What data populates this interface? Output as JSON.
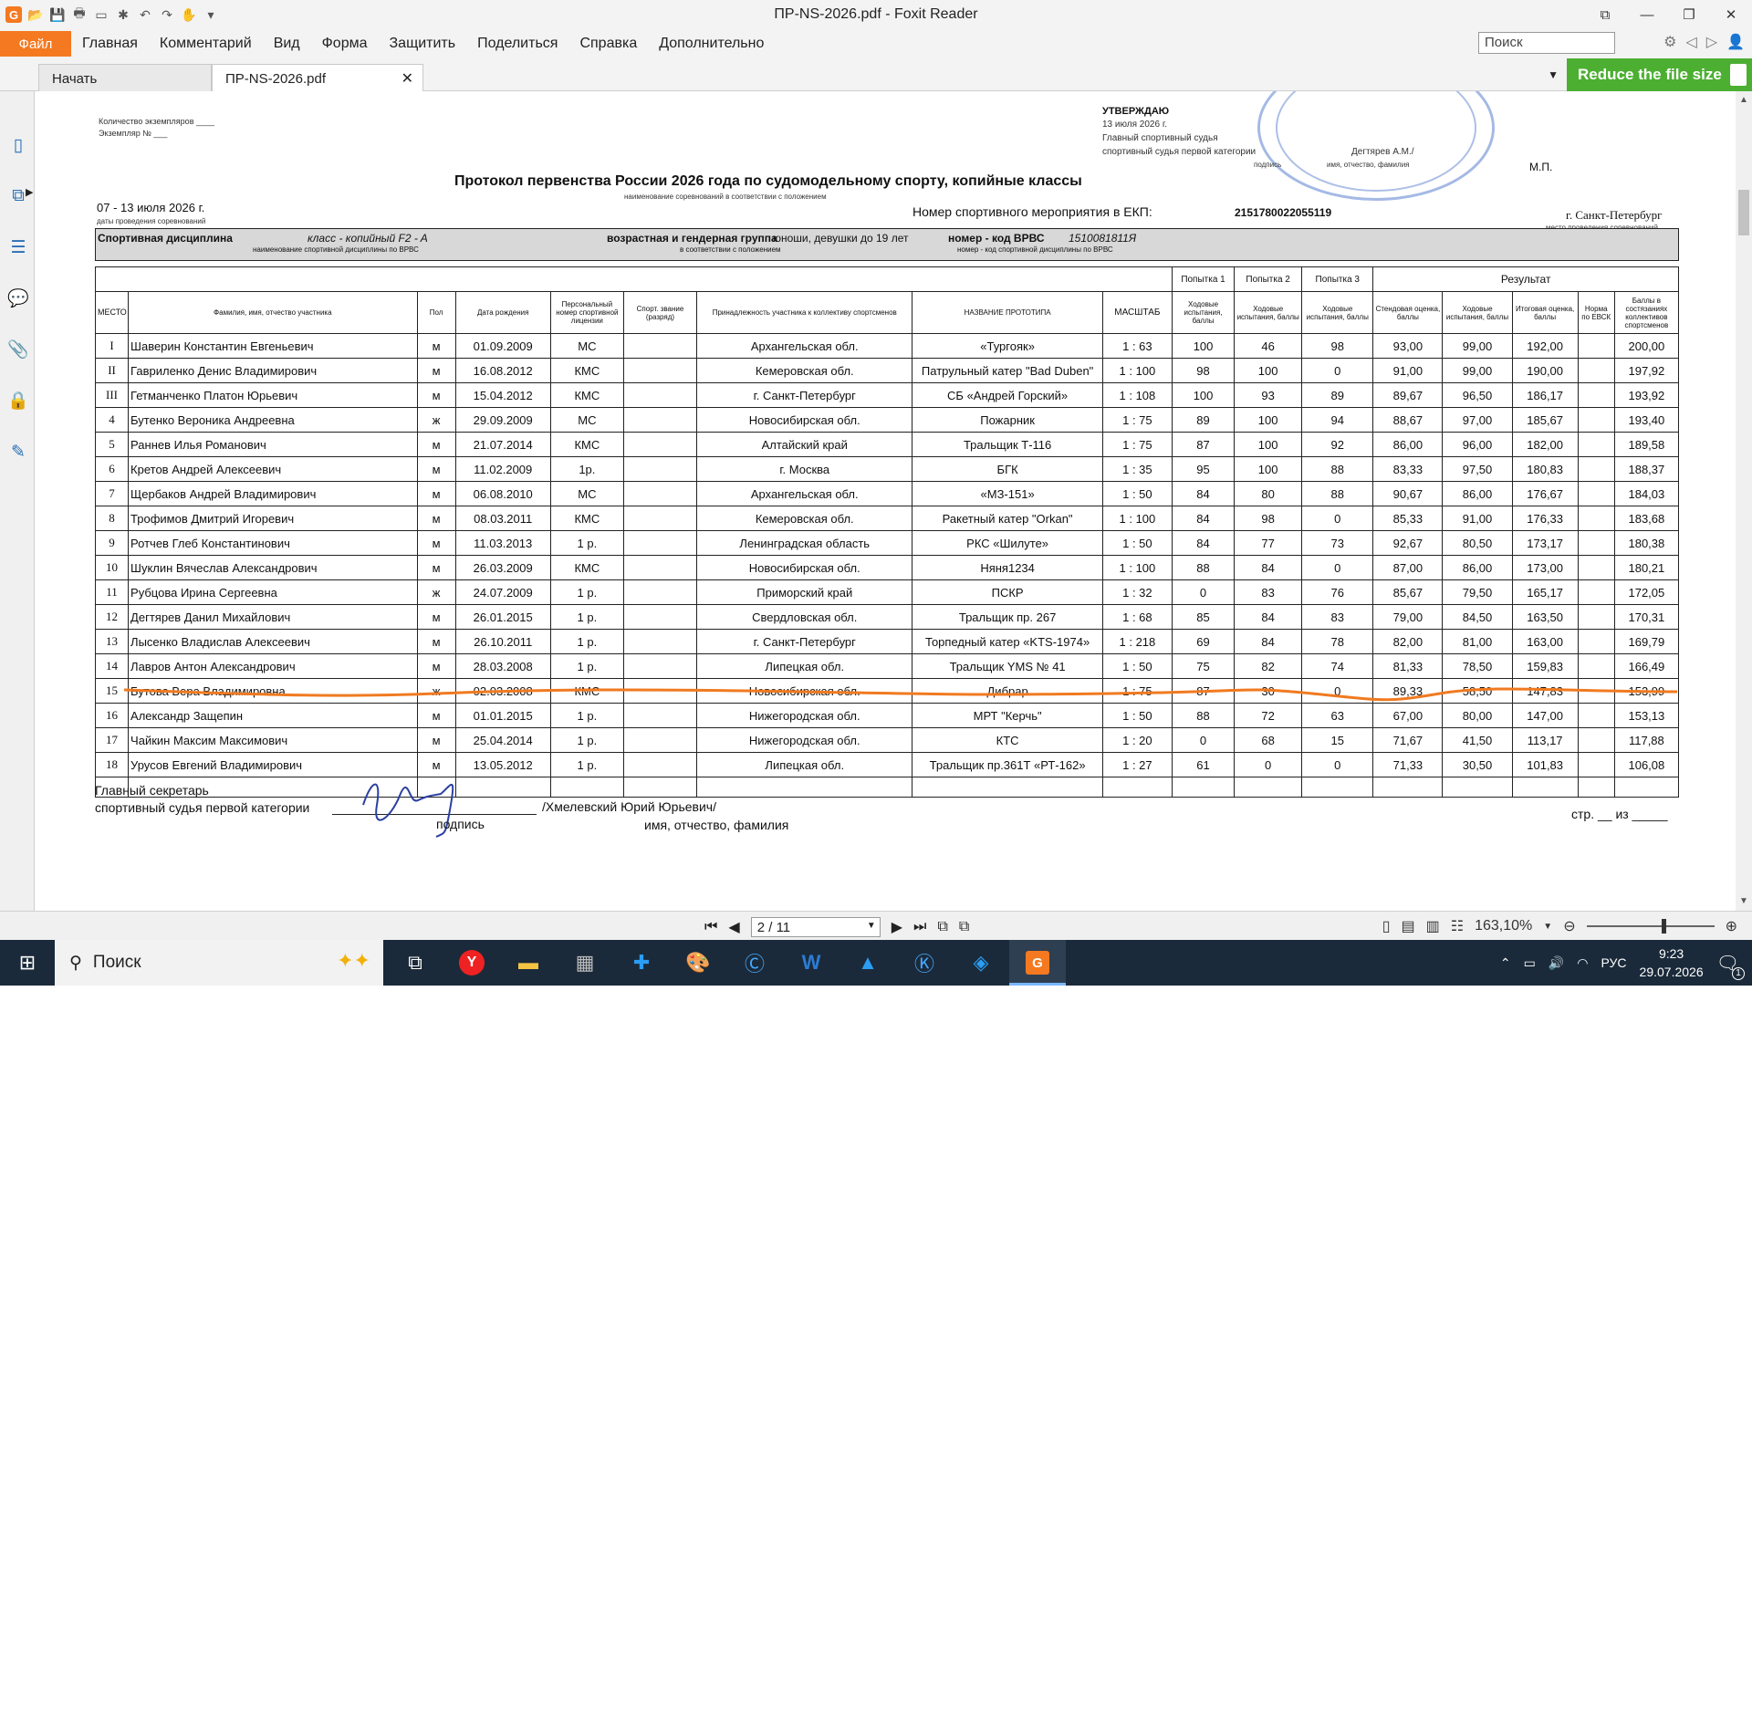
{
  "window": {
    "title": "ПР-NS-2026.pdf - Foxit Reader"
  },
  "menu": {
    "file": "Файл",
    "items": [
      "Главная",
      "Комментарий",
      "Вид",
      "Форма",
      "Защитить",
      "Поделиться",
      "Справка",
      "Дополнительно"
    ],
    "search_placeholder": "Поиск"
  },
  "tabs": [
    {
      "label": "Начать"
    },
    {
      "label": "ПР-NS-2026.pdf"
    }
  ],
  "promo": {
    "label": "Reduce the file size"
  },
  "status": {
    "page": "2 / 11",
    "zoom": "163,10%"
  },
  "taskbar": {
    "search": "Поиск",
    "lang": "РУС",
    "time": "9:23",
    "date": "29.07.2026",
    "notifications": "1"
  },
  "document": {
    "copies": "Количество экземпляров ____",
    "copy_no": "Экземпляр № ___",
    "approve": "УТВЕРЖДАЮ",
    "approve_date": "13 июля 2026 г.",
    "approve_role1": "Главный спортивный судья",
    "approve_role2": "спортивный судья первой категории",
    "approve_sign": "подпись",
    "approve_name": "Дегтярев А.М./",
    "approve_name_caption": "имя, отчество, фамилия",
    "mp": "М.П.",
    "title": "Протокол первенства России 2026 года по судомодельному спорту, копийные классы",
    "title_caption": "наименование соревнований в соответствии с положением",
    "dates": "07 - 13 июля 2026 г.",
    "dates_caption": "даты проведения соревнований",
    "ekp_label": "Номер спортивного мероприятия в ЕКП:",
    "ekp_value": "2151780022055119",
    "city": "г. Санкт-Петербург",
    "city_caption": "место проведения соревнований",
    "discipline_label": "Спортивная дисциплина",
    "discipline_value": "класс - копийный  F2 - A",
    "discipline_caption": "наименование спортивной дисциплины по ВРВС",
    "age_label": "возрастная и гендерная группа",
    "age_value": "юноши, девушки до 19 лет",
    "age_caption": "в соответствии с положением",
    "code_label": "номер - код ВРВС",
    "code_value": "1510081811Я",
    "code_caption": "номер - код спортивной дисциплины по ВРВС",
    "columns": {
      "place": "МЕСТО",
      "name": "Фамилия, имя, отчество участника",
      "sex": "Пол",
      "birth": "Дата рождения",
      "license": "Персональный номер спортивной лицензии",
      "rank": "Спорт. звание (разряд)",
      "team": "Принадлежность участника к коллективу спортсменов",
      "proto": "НАЗВАНИЕ ПРОТОТИПА",
      "scale": "МАСШТАБ",
      "try1": "Попытка 1",
      "try2": "Попытка 2",
      "try3": "Попытка 3",
      "run": "Ходовые испытания, баллы",
      "result": "Результат",
      "stand": "Стендовая оценка, баллы",
      "run_res": "Ходовые испытания, баллы",
      "total": "Итоговая оценка, баллы",
      "norm": "Норма по ЕВСК",
      "points": "Баллы в состязаниях коллективов спортсменов"
    },
    "rows": [
      [
        "I",
        "Шаверин Константин Евгеньевич",
        "м",
        "01.09.2009",
        "МС",
        "",
        "Архангельская обл.",
        "«Тургояк»",
        "1 : 63",
        "100",
        "46",
        "98",
        "93,00",
        "99,00",
        "192,00",
        "",
        "200,00"
      ],
      [
        "II",
        "Гавриленко Денис Владимирович",
        "м",
        "16.08.2012",
        "КМС",
        "",
        "Кемеровская обл.",
        "Патрульный катер \"Bad Duben\"",
        "1 : 100",
        "98",
        "100",
        "0",
        "91,00",
        "99,00",
        "190,00",
        "",
        "197,92"
      ],
      [
        "III",
        "Гетманченко Платон Юрьевич",
        "м",
        "15.04.2012",
        "КМС",
        "",
        "г. Санкт-Петербург",
        "СБ «Андрей Горский»",
        "1 : 108",
        "100",
        "93",
        "89",
        "89,67",
        "96,50",
        "186,17",
        "",
        "193,92"
      ],
      [
        "4",
        "Бутенко Вероника Андреевна",
        "ж",
        "29.09.2009",
        "МС",
        "",
        "Новосибирская обл.",
        "Пожарник",
        "1 : 75",
        "89",
        "100",
        "94",
        "88,67",
        "97,00",
        "185,67",
        "",
        "193,40"
      ],
      [
        "5",
        "Раннев Илья Романович",
        "м",
        "21.07.2014",
        "КМС",
        "",
        "Алтайский край",
        "Тральщик Т-116",
        "1 : 75",
        "87",
        "100",
        "92",
        "86,00",
        "96,00",
        "182,00",
        "",
        "189,58"
      ],
      [
        "6",
        "Кретов  Андрей  Алексеевич",
        "м",
        "11.02.2009",
        "1р.",
        "",
        "г. Москва",
        "БГК",
        "1 : 35",
        "95",
        "100",
        "88",
        "83,33",
        "97,50",
        "180,83",
        "",
        "188,37"
      ],
      [
        "7",
        "Щербаков Андрей Владимирович",
        "м",
        "06.08.2010",
        "МС",
        "",
        "Архангельская обл.",
        "«МЗ-151»",
        "1 : 50",
        "84",
        "80",
        "88",
        "90,67",
        "86,00",
        "176,67",
        "",
        "184,03"
      ],
      [
        "8",
        "Трофимов Дмитрий Игоревич",
        "м",
        "08.03.2011",
        "КМС",
        "",
        "Кемеровская обл.",
        "Ракетный катер \"Orkan\"",
        "1 : 100",
        "84",
        "98",
        "0",
        "85,33",
        "91,00",
        "176,33",
        "",
        "183,68"
      ],
      [
        "9",
        "Ротчев Глеб Константинович",
        "м",
        "11.03.2013",
        "1 р.",
        "",
        "Ленинградская область",
        "РКС «Шилуте»",
        "1 : 50",
        "84",
        "77",
        "73",
        "92,67",
        "80,50",
        "173,17",
        "",
        "180,38"
      ],
      [
        "10",
        "Шуклин Вячеслав Александрович",
        "м",
        "26.03.2009",
        "КМС",
        "",
        "Новосибирская обл.",
        "Няня1234",
        "1 : 100",
        "88",
        "84",
        "0",
        "87,00",
        "86,00",
        "173,00",
        "",
        "180,21"
      ],
      [
        "11",
        "Рубцова Ирина Сергеевна",
        "ж",
        "24.07.2009",
        "1 р.",
        "",
        "Приморский край",
        "ПСКР",
        "1 : 32",
        "0",
        "83",
        "76",
        "85,67",
        "79,50",
        "165,17",
        "",
        "172,05"
      ],
      [
        "12",
        "Дегтярев Данил Михайлович",
        "м",
        "26.01.2015",
        "1 р.",
        "",
        "Свердловская обл.",
        "Тральщик пр. 267",
        "1 : 68",
        "85",
        "84",
        "83",
        "79,00",
        "84,50",
        "163,50",
        "",
        "170,31"
      ],
      [
        "13",
        "Лысенко Владислав Алексеевич",
        "м",
        "26.10.2011",
        "1 р.",
        "",
        "г. Санкт-Петербург",
        "Торпедный катер «KTS-1974»",
        "1 : 218",
        "69",
        "84",
        "78",
        "82,00",
        "81,00",
        "163,00",
        "",
        "169,79"
      ],
      [
        "14",
        "Лавров Антон Александрович",
        "м",
        "28.03.2008",
        "1 р.",
        "",
        "Липецкая обл.",
        "Тральщик YMS № 41",
        "1 : 50",
        "75",
        "82",
        "74",
        "81,33",
        "78,50",
        "159,83",
        "",
        "166,49"
      ],
      [
        "15",
        "Бутова Вера Владимировна",
        "ж",
        "02.03.2008",
        "КМС",
        "",
        "Новосибирская обл.",
        "Дибрар",
        "1 : 75",
        "87",
        "30",
        "0",
        "89,33",
        "58,50",
        "147,83",
        "",
        "153,99"
      ],
      [
        "16",
        "Александр Защепин",
        "м",
        "01.01.2015",
        "1 р.",
        "",
        "Нижегородская обл.",
        "МРТ \"Керчь\"",
        "1 : 50",
        "88",
        "72",
        "63",
        "67,00",
        "80,00",
        "147,00",
        "",
        "153,13"
      ],
      [
        "17",
        "Чайкин Максим Максимович",
        "м",
        "25.04.2014",
        "1 р.",
        "",
        "Нижегородская обл.",
        "КТС",
        "1 : 20",
        "0",
        "68",
        "15",
        "71,67",
        "41,50",
        "113,17",
        "",
        "117,88"
      ],
      [
        "18",
        "Урусов Евгений Владимирович",
        "м",
        "13.05.2012",
        "1 р.",
        "",
        "Липецкая обл.",
        "Тральщик пр.361Т «РТ-162»",
        "1 : 27",
        "61",
        "0",
        "0",
        "71,33",
        "30,50",
        "101,83",
        "",
        "106,08"
      ]
    ],
    "secretary_role1": "Главный секретарь",
    "secretary_role2": "спортивный судья первой категории",
    "secretary_name": "/Хмелевский Юрий Юрьевич/",
    "secretary_sign": "подпись",
    "secretary_caption": "имя, отчество, фамилия",
    "page_of": "стр. __ из _____"
  },
  "colors": {
    "accent": "#f47920",
    "promo": "#4caf32",
    "annotation_line": "#f07a20"
  }
}
